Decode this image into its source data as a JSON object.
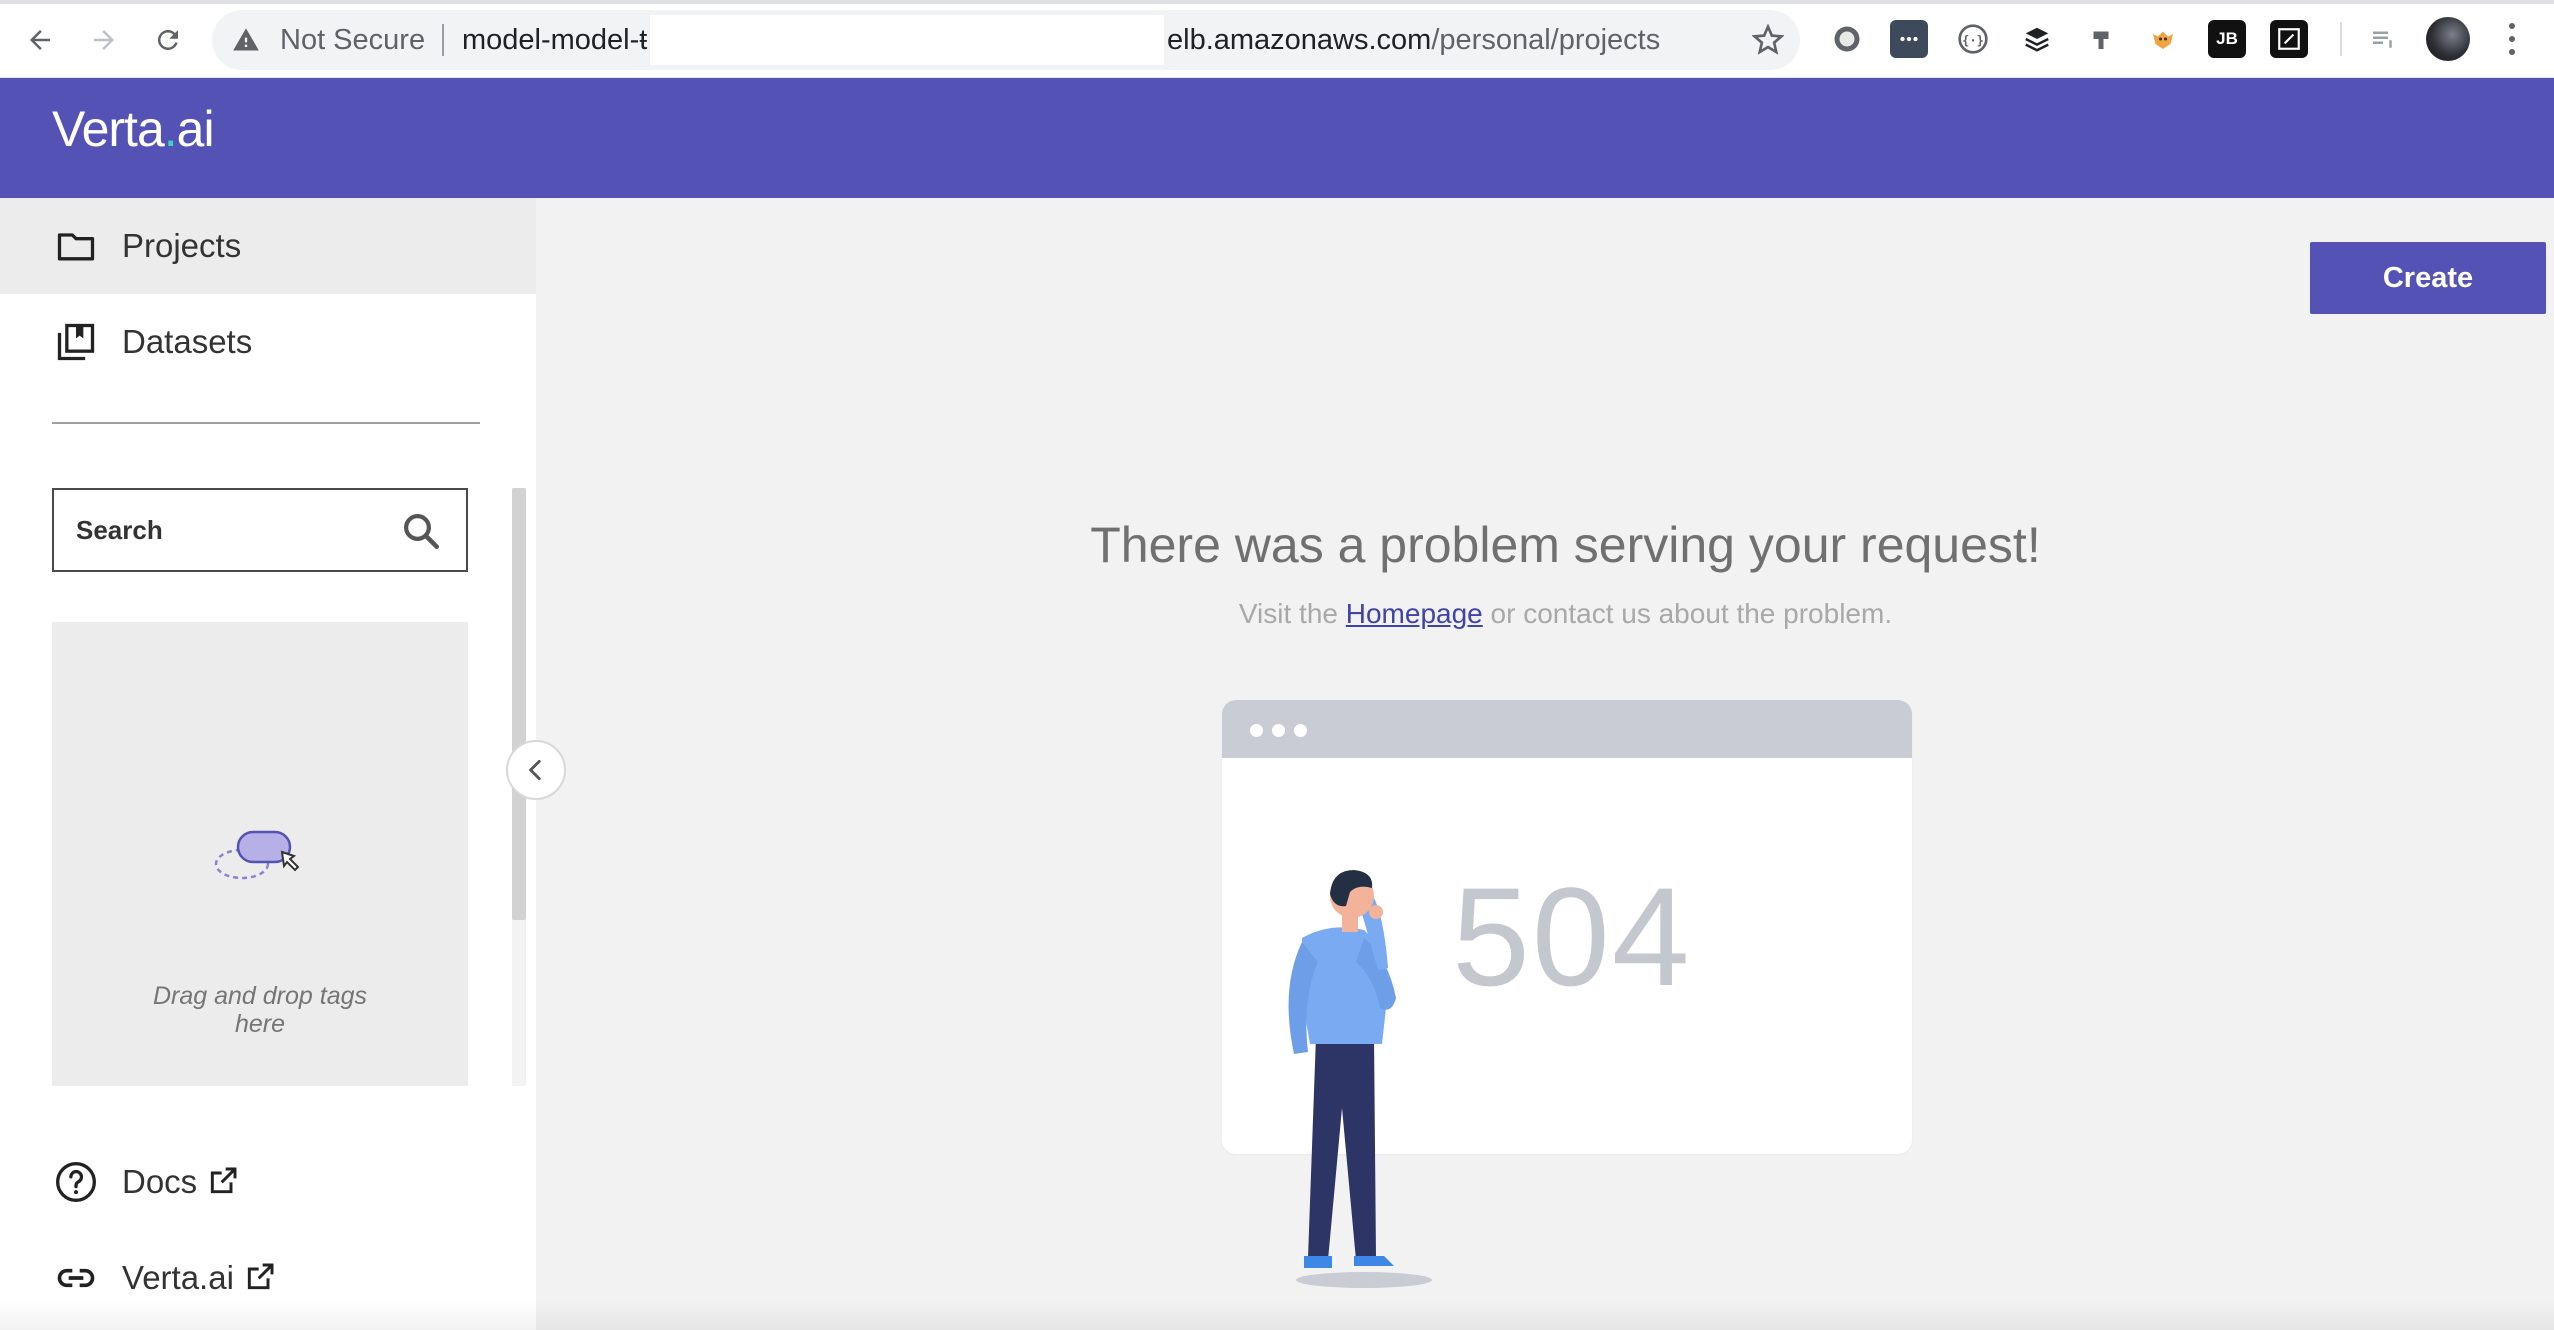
{
  "browser": {
    "security_label": "Not Secure",
    "url_prefix": "model-model-ŧ",
    "url_host_tail": "elb.amazonaws.com",
    "url_path": "/personal/projects",
    "extensions": [
      "github-icon",
      "more-dots-extension-icon",
      "json-formatter-icon",
      "buffer-icon",
      "pin-icon",
      "fox-icon",
      "jb-icon",
      "pen-icon",
      "reader-icon"
    ],
    "jb_label": "JB"
  },
  "app": {
    "logo_main": "Verta",
    "logo_dot": ".",
    "logo_tail": "ai",
    "brand_color": "#5452b4"
  },
  "sidebar": {
    "items": [
      {
        "label": "Projects",
        "icon": "folder-icon",
        "active": true
      },
      {
        "label": "Datasets",
        "icon": "datasets-icon",
        "active": false
      }
    ],
    "search_placeholder": "Search",
    "tag_drop_line1": "Drag and drop tags",
    "tag_drop_line2": "here",
    "links": [
      {
        "label": "Docs",
        "icon": "help-circle-icon"
      },
      {
        "label": "Verta.ai",
        "icon": "link-icon"
      }
    ]
  },
  "main": {
    "create_label": "Create",
    "error_title": "There was a problem serving your request!",
    "error_sub_before": "Visit the ",
    "error_sub_link": "Homepage",
    "error_sub_after": " or contact us about the problem.",
    "error_code": "504"
  }
}
